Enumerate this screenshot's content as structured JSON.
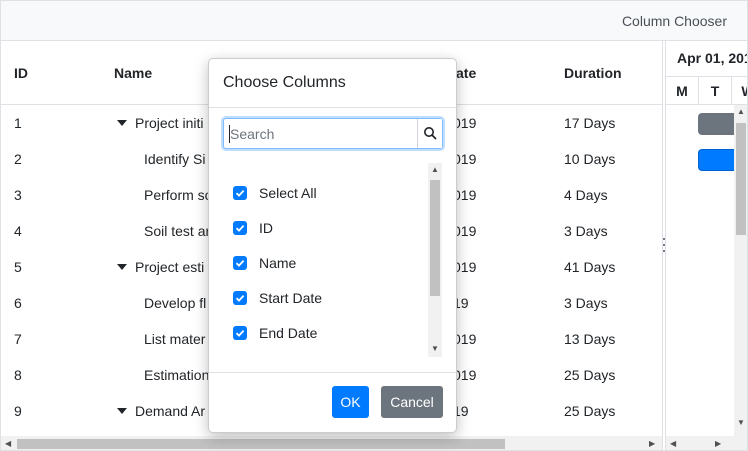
{
  "toolbar": {
    "column_chooser_label": "Column Chooser"
  },
  "grid": {
    "columns": [
      "ID",
      "Name",
      "ate",
      "Duration"
    ],
    "rows": [
      {
        "id": "1",
        "name": "Project initi",
        "date": "019",
        "duration": "17 Days",
        "expanded": true
      },
      {
        "id": "2",
        "name": "Identify Si",
        "date": "019",
        "duration": "10 Days"
      },
      {
        "id": "3",
        "name": "Perform so",
        "date": "019",
        "duration": "4 Days"
      },
      {
        "id": "4",
        "name": "Soil test ar",
        "date": "019",
        "duration": "3 Days"
      },
      {
        "id": "5",
        "name": "Project esti",
        "date": "019",
        "duration": "41 Days",
        "expanded": true
      },
      {
        "id": "6",
        "name": "Develop fl",
        "date": "19",
        "duration": "3 Days"
      },
      {
        "id": "7",
        "name": "List mater",
        "date": "019",
        "duration": "13 Days"
      },
      {
        "id": "8",
        "name": "Estimation",
        "date": "019",
        "duration": "25 Days"
      },
      {
        "id": "9",
        "name": "Demand Ar",
        "date": "19",
        "duration": "25 Days",
        "expanded": true
      }
    ]
  },
  "chart": {
    "month_label": "Apr 01, 201",
    "days": [
      "M",
      "T",
      "W"
    ],
    "bar_colors": [
      "#6c757d",
      "#007bff"
    ]
  },
  "dialog": {
    "title": "Choose Columns",
    "search_placeholder": "Search",
    "items": [
      {
        "label": "Select All",
        "checked": true
      },
      {
        "label": "ID",
        "checked": true
      },
      {
        "label": "Name",
        "checked": true
      },
      {
        "label": "Start Date",
        "checked": true
      },
      {
        "label": "End Date",
        "checked": true
      }
    ],
    "ok_label": "OK",
    "cancel_label": "Cancel"
  },
  "colors": {
    "primary": "#007bff",
    "secondary": "#6c757d",
    "border": "#dee2e6"
  }
}
